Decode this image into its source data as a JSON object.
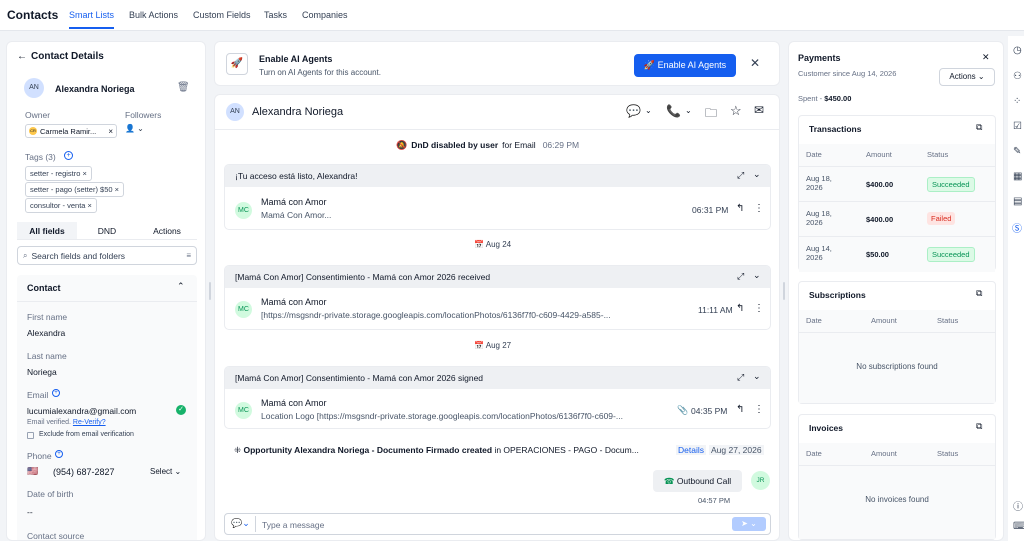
{
  "topnav": {
    "brand": "Contacts",
    "tabs": [
      "Smart Lists",
      "Bulk Actions",
      "Custom Fields",
      "Tasks",
      "Companies"
    ]
  },
  "left": {
    "title": "Contact Details",
    "contact_initials": "AN",
    "contact_name": "Alexandra Noriega",
    "owner_label": "Owner",
    "owner_initials": "CR",
    "owner_name": "Carmela Ramir...",
    "followers_label": "Followers",
    "tags_label": "Tags (3)",
    "tags": [
      "setter - registro",
      "setter - pago (setter) $50",
      "consultor - venta"
    ],
    "tabs": [
      "All fields",
      "DND",
      "Actions"
    ],
    "search_placeholder": "Search fields and folders",
    "section_title": "Contact",
    "first_name_label": "First name",
    "first_name": "Alexandra",
    "last_name_label": "Last name",
    "last_name": "Noriega",
    "email_label": "Email",
    "email": "lucumialexandra@gmail.com",
    "email_verified": "Email verified.",
    "reverify": "Re-Verify?",
    "exclude_label": "Exclude from email verification",
    "phone_label": "Phone",
    "phone": "(954) 687-2827",
    "phone_select": "Select",
    "dob_label": "Date of birth",
    "dob_value": "--",
    "contact_source_label": "Contact source"
  },
  "banner": {
    "title": "Enable AI Agents",
    "subtitle": "Turn on AI Agents for this account.",
    "button": "Enable AI Agents"
  },
  "convo": {
    "initials": "AN",
    "name": "Alexandra Noriega",
    "dnd_bold": "DnD disabled by user",
    "dnd_rest": " for Email",
    "dnd_time": "06:29 PM",
    "threads": [
      {
        "subject": "¡Tu acceso está listo, Alexandra!",
        "sender": "Mamá con Amor",
        "preview": "Mamá Con Amor...",
        "time": "06:31 PM"
      },
      {
        "subject": "[Mamá Con Amor] Consentimiento - Mamá con Amor 2026 received",
        "sender": "Mamá con Amor",
        "preview": "[https://msgsndr-private.storage.googleapis.com/locationPhotos/6136f7f0-c609-4429-a585-...",
        "time": "11:11 AM"
      },
      {
        "subject": "[Mamá Con Amor] Consentimiento - Mamá con Amor 2026 signed",
        "sender": "Mamá con Amor",
        "preview": "Location Logo [https://msgsndr-private.storage.googleapis.com/locationPhotos/6136f7f0-c609-...",
        "time": "04:35 PM"
      }
    ],
    "date1": "Aug 24",
    "date2": "Aug 27",
    "avatar_initials": "MC",
    "opportunity_bold": "Opportunity Alexandra Noriega - Documento Firmado created",
    "opportunity_rest": " in OPERACIONES - PAGO - Docum...",
    "opportunity_details": "Details",
    "opportunity_date": "Aug 27, 2026",
    "outbound_label": "Outbound Call",
    "outbound_time": "04:57 PM",
    "outbound_initials": "JR",
    "composer_placeholder": "Type a message"
  },
  "right": {
    "payments_title": "Payments",
    "customer_since": "Customer since Aug 14, 2026",
    "spent_label": "Spent - ",
    "spent_value": "$450.00",
    "actions_label": "Actions",
    "transactions_title": "Transactions",
    "headers": [
      "Date",
      "Amount",
      "Status"
    ],
    "transactions": [
      {
        "date": "Aug 18, 2026",
        "amount": "$400.00",
        "status": "Succeeded"
      },
      {
        "date": "Aug 18, 2026",
        "amount": "$400.00",
        "status": "Failed"
      },
      {
        "date": "Aug 14, 2026",
        "amount": "$50.00",
        "status": "Succeeded"
      }
    ],
    "subscriptions_title": "Subscriptions",
    "subscriptions_empty": "No subscriptions found",
    "invoices_title": "Invoices",
    "invoices_empty": "No invoices found"
  },
  "colors": {
    "accent": "#155eef",
    "success_bg": "#dcfae6",
    "success_text": "#079455",
    "fail_bg": "#fee4e2",
    "fail_text": "#d92d20"
  }
}
